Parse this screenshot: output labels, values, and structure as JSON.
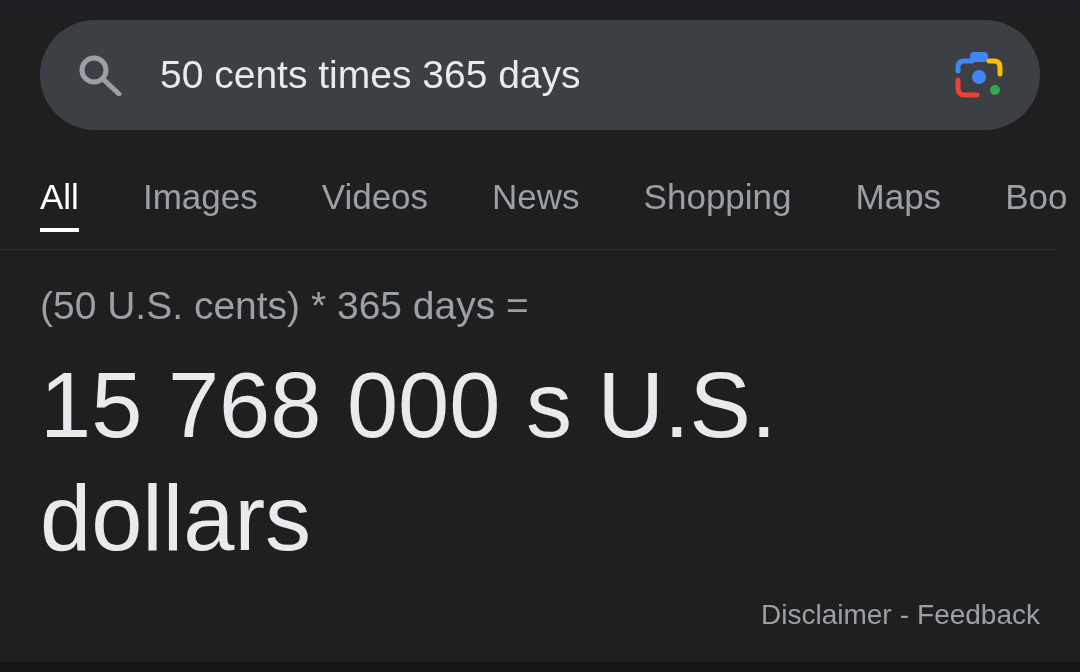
{
  "search": {
    "query": "50 cents times 365 days"
  },
  "tabs": [
    {
      "label": "All",
      "selected": true
    },
    {
      "label": "Images",
      "selected": false
    },
    {
      "label": "Videos",
      "selected": false
    },
    {
      "label": "News",
      "selected": false
    },
    {
      "label": "Shopping",
      "selected": false
    },
    {
      "label": "Maps",
      "selected": false
    },
    {
      "label": "Boo",
      "selected": false
    }
  ],
  "calculator": {
    "expression": "(50 U.S. cents) * 365 days =",
    "result": "15 768 000 s U.S. dollars"
  },
  "footer": {
    "links": [
      "Disclaimer",
      "Feedback"
    ],
    "separator": "-"
  }
}
